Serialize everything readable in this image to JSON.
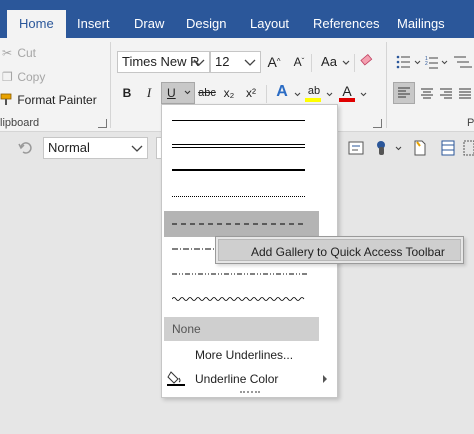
{
  "tabs": [
    "Home",
    "Insert",
    "Draw",
    "Design",
    "Layout",
    "References",
    "Mailings"
  ],
  "clipboard": {
    "cut": "Cut",
    "copy": "Copy",
    "format_painter": "Format Painter",
    "group_label": "lipboard"
  },
  "font": {
    "name": "Times New R",
    "size": "12",
    "bold": "B",
    "italic": "I",
    "underline": "U",
    "strikethrough": "abc",
    "subscript": "x₂",
    "superscript": "x²",
    "grow": "A",
    "shrink": "A",
    "change_case": "Aa",
    "font_color_letter": "A",
    "highlight_letter": "ab"
  },
  "paragraph_partial": "P",
  "style_box": {
    "value": "Normal"
  },
  "underline_menu": {
    "line_styles": [
      "single",
      "double",
      "thick",
      "dotted",
      "dashed",
      "dash-dot",
      "dash-dot-dot",
      "wave"
    ],
    "selected_style": "dashed",
    "none_label": "None",
    "more_underlines": "More Underlines...",
    "underline_color": "Underline Color"
  },
  "context_menu": {
    "add_gallery": "Add Gallery to Quick Access Toolbar"
  },
  "colors": {
    "tab_bar": "#2b579a",
    "ribbon": "#f3f3f3",
    "highlight_yellow": "#ffff00",
    "font_red": "#e00000",
    "selection_grey": "#b4b4b4"
  }
}
